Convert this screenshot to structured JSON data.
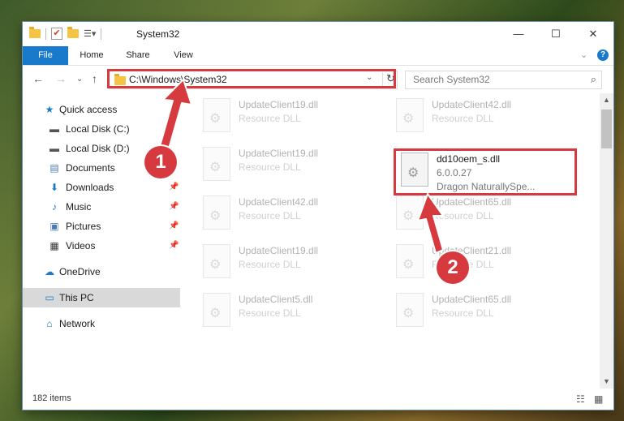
{
  "window": {
    "title": "System32",
    "controls": {
      "minimize": "—",
      "maximize": "☐",
      "close": "✕"
    }
  },
  "ribbon": {
    "tabs": [
      "File",
      "Home",
      "Share",
      "View"
    ],
    "collapse_icon": "chevron-down-icon",
    "help_icon": "help-icon"
  },
  "address": {
    "path": "C:\\Windows\\System32",
    "dropdown": "⌄",
    "refresh": "↻"
  },
  "search": {
    "placeholder": "Search System32"
  },
  "sidebar": {
    "items": [
      {
        "label": "Quick access",
        "icon": "star-icon",
        "pinned": false
      },
      {
        "label": "Local Disk (C:)",
        "icon": "drive-icon",
        "pinned": false
      },
      {
        "label": "Local Disk (D:)",
        "icon": "drive-icon",
        "pinned": false
      },
      {
        "label": "Documents",
        "icon": "document-icon",
        "pinned": true
      },
      {
        "label": "Downloads",
        "icon": "download-icon",
        "pinned": true
      },
      {
        "label": "Music",
        "icon": "music-icon",
        "pinned": true
      },
      {
        "label": "Pictures",
        "icon": "pictures-icon",
        "pinned": true
      },
      {
        "label": "Videos",
        "icon": "videos-icon",
        "pinned": true
      },
      {
        "label": "OneDrive",
        "icon": "cloud-icon",
        "pinned": false
      },
      {
        "label": "This PC",
        "icon": "computer-icon",
        "pinned": false,
        "selected": true
      },
      {
        "label": "Network",
        "icon": "network-icon",
        "pinned": false
      }
    ]
  },
  "files": [
    {
      "name": "UpdateClient19.dll",
      "type": "Resource DLL"
    },
    {
      "name": "UpdateClient42.dll",
      "type": "Resource DLL"
    },
    {
      "name": "UpdateClient19.dll",
      "type": "Resource DLL"
    },
    {
      "name": "dd10oem_s.dll",
      "type": "6.0.0.27",
      "extra": "Dragon NaturallySpe...",
      "highlighted": true
    },
    {
      "name": "UpdateClient42.dll",
      "type": "Resource DLL"
    },
    {
      "name": "UpdateClient65.dll",
      "type": "Resource DLL"
    },
    {
      "name": "UpdateClient19.dll",
      "type": "Resource DLL"
    },
    {
      "name": "UpdateClient21.dll",
      "type": "Resource DLL"
    },
    {
      "name": "UpdateClient5.dll",
      "type": "Resource DLL"
    },
    {
      "name": "UpdateClient65.dll",
      "type": "Resource DLL"
    }
  ],
  "status": {
    "items": "182 items"
  },
  "callouts": {
    "one": "1",
    "two": "2"
  },
  "colors": {
    "accent": "#1979ca",
    "highlight": "#d63a3f"
  }
}
